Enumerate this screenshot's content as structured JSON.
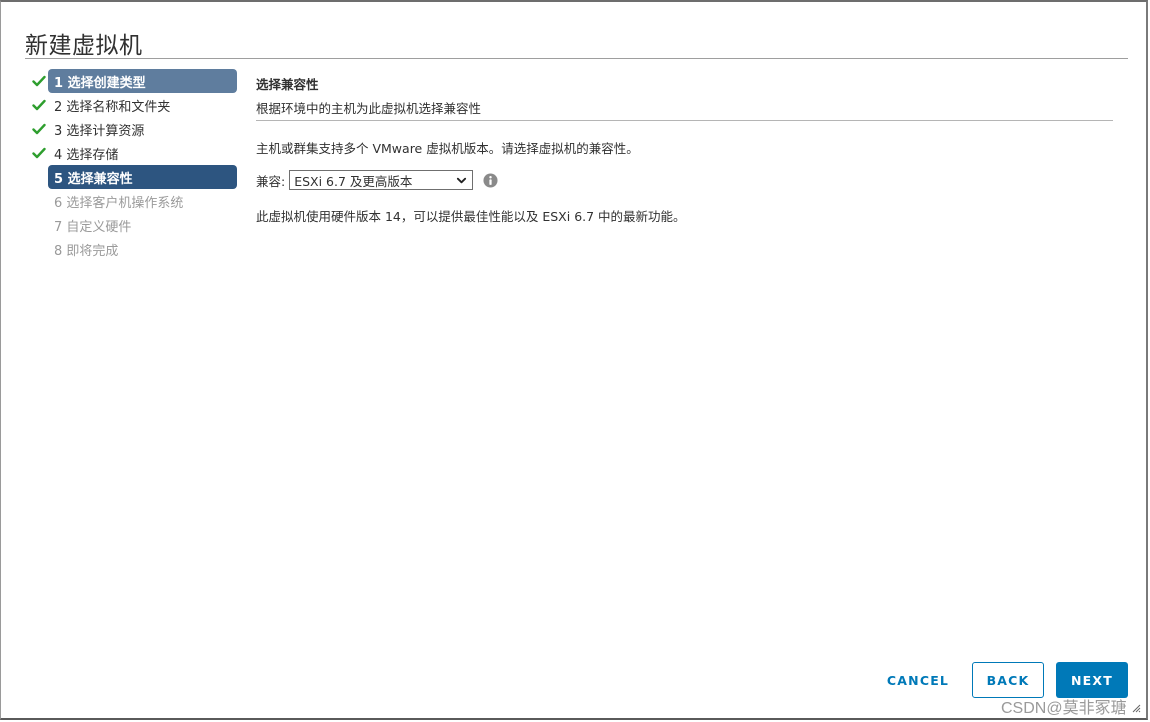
{
  "dialog": {
    "title": "新建虚拟机"
  },
  "steps": [
    {
      "label": "1 选择创建类型",
      "state": "completed",
      "check": "check-icon"
    },
    {
      "label": "2 选择名称和文件夹",
      "state": "completed",
      "check": "check-icon"
    },
    {
      "label": "3 选择计算资源",
      "state": "completed",
      "check": "check-icon"
    },
    {
      "label": "4 选择存储",
      "state": "completed",
      "check": "check-icon"
    },
    {
      "label": "5 选择兼容性",
      "state": "active"
    },
    {
      "label": "6 选择客户机操作系统",
      "state": "pending"
    },
    {
      "label": "7 自定义硬件",
      "state": "pending"
    },
    {
      "label": "8 即将完成",
      "state": "pending"
    }
  ],
  "content": {
    "section_title": "选择兼容性",
    "section_subtitle": "根据环境中的主机为此虚拟机选择兼容性",
    "description": "主机或群集支持多个 VMware 虚拟机版本。请选择虚拟机的兼容性。",
    "compat_label": "兼容:",
    "compat_selected": "ESXi 6.7 及更高版本",
    "info_icon": "info-icon",
    "hardware_note": "此虚拟机使用硬件版本 14，可以提供最佳性能以及 ESXi 6.7 中的最新功能。"
  },
  "footer": {
    "cancel_label": "CANCEL",
    "back_label": "BACK",
    "next_label": "NEXT"
  },
  "watermark": "CSDN@莫非冢瑭",
  "colors": {
    "accent": "#0079b8",
    "active_step": "#2d5580",
    "first_step": "#5f7d9e",
    "check": "#2e9e2e"
  }
}
